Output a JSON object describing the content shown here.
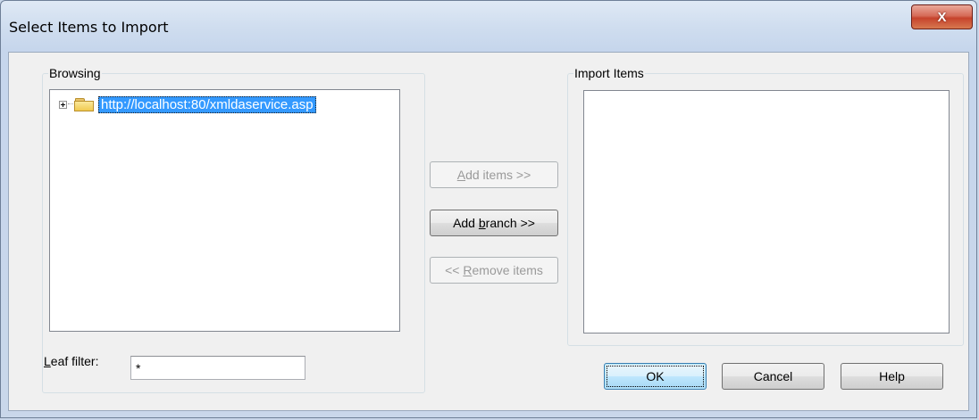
{
  "window": {
    "title": "Select Items to Import",
    "close_glyph": "X"
  },
  "browsing": {
    "label": "Browsing",
    "tree": [
      {
        "label": "http://localhost:80/xmldaservice.asp",
        "expanded": false,
        "selected": true,
        "icon": "folder-icon"
      }
    ]
  },
  "import_items": {
    "label": "Import Items",
    "items": []
  },
  "buttons": {
    "add_items": {
      "mnemonic": "A",
      "rest": "dd items >>",
      "enabled": false
    },
    "add_branch": {
      "before": "Add ",
      "mnemonic": "b",
      "rest": "ranch >>",
      "enabled": true
    },
    "remove_items": {
      "before": "<< ",
      "mnemonic": "R",
      "rest": "emove items",
      "enabled": false
    },
    "ok": "OK",
    "cancel": "Cancel",
    "help": "Help"
  },
  "leaf_filter": {
    "mnemonic": "L",
    "rest": "eaf filter:",
    "value": "*"
  },
  "colors": {
    "selection": "#3399ff",
    "close_button": "#c6432d",
    "dialog_bg": "#f0f0f0"
  }
}
